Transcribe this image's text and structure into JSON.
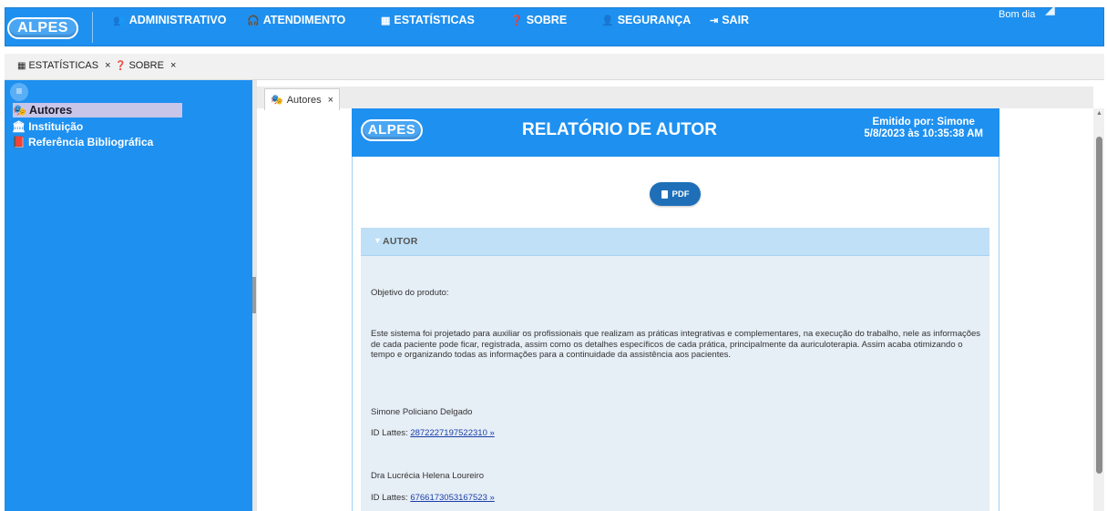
{
  "app": {
    "logo_text": "ALPES",
    "greeting": "Bom dia"
  },
  "nav": [
    {
      "label": "ADMINISTRATIVO",
      "icon": "users-icon",
      "glyph": "👥"
    },
    {
      "label": "ATENDIMENTO",
      "icon": "headset-icon",
      "glyph": "🎧"
    },
    {
      "label": "ESTATÍSTICAS",
      "icon": "chart-icon",
      "glyph": "▦"
    },
    {
      "label": "SOBRE",
      "icon": "question-icon",
      "glyph": "❓"
    },
    {
      "label": "SEGURANÇA",
      "icon": "user-plus-icon",
      "glyph": "👤"
    },
    {
      "label": "SAIR",
      "icon": "sign-out-icon",
      "glyph": "⇥"
    }
  ],
  "tabs": [
    {
      "label": "ESTATÍSTICAS",
      "icon": "chart-icon",
      "glyph": "▦",
      "close": "×"
    },
    {
      "label": "SOBRE",
      "icon": "question-icon",
      "glyph": "❓",
      "close": "×"
    }
  ],
  "sidebar": {
    "toggle_glyph": "≡",
    "items": [
      {
        "label": "Autores",
        "icon": "authors-icon",
        "glyph": "🎭",
        "active": true
      },
      {
        "label": "Instituição",
        "icon": "institution-icon",
        "glyph": "🏛",
        "active": false
      },
      {
        "label": "Referência Bibliográfica",
        "icon": "book-icon",
        "glyph": "📕",
        "active": false
      }
    ]
  },
  "inner_tab": {
    "label": "Autores",
    "icon": "authors-icon",
    "glyph": "🎭",
    "close": "×"
  },
  "report": {
    "logo_text": "ALPES",
    "title": "RELATÓRIO DE AUTOR",
    "issued_by": "Emitido por: Simone",
    "issued_at": "5/8/2023 às 10:35:38 AM",
    "pdf_label": "PDF",
    "section_label": "AUTOR",
    "objective_label": "Objetivo do produto:",
    "paragraph": "Este sistema foi projetado para auxiliar os profissionais que realizam as práticas integrativas e complementares, na execução do trabalho, nele as informações de cada paciente pode ficar, registrada, assim como os detalhes específicos de cada prática, principalmente da auriculoterapia. Assim acaba otimizando o tempo e organizando todas as informações para a continuidade da assistência aos pacientes.",
    "authors": [
      {
        "name": "Simone Policiano Delgado",
        "lattes_label": "ID Lattes:",
        "lattes_id": "2872227197522310 »"
      },
      {
        "name": "Dra Lucrécia Helena Loureiro",
        "lattes_label": "ID Lattes:",
        "lattes_id": "6766173053167523 »"
      }
    ]
  },
  "colors": {
    "primary": "#1e90f0",
    "section_head": "#bfe0f7",
    "section_body": "#e6eef6",
    "pdf_button": "#1e6fb8"
  }
}
